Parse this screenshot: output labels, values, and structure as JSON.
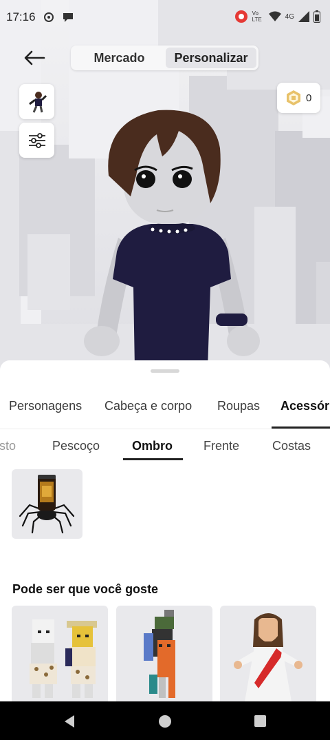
{
  "status": {
    "time": "17:16",
    "network": "4G",
    "volte": "Vo LTE"
  },
  "header": {
    "tabs": [
      "Mercado",
      "Personalizar"
    ],
    "active_tab": "Personalizar",
    "robux_balance": "0"
  },
  "categories": [
    "Personagens",
    "Cabeça e corpo",
    "Roupas",
    "Acessórios"
  ],
  "active_category": "Acessórios",
  "subcategories": [
    "Rosto",
    "Pescoço",
    "Ombro",
    "Frente",
    "Costas"
  ],
  "active_subcategory": "Ombro",
  "recommendations": {
    "title": "Pode ser que você goste"
  },
  "colors": {
    "accent": "#222222",
    "shirt": "#1e1b3f",
    "hair": "#4a2c1e"
  }
}
